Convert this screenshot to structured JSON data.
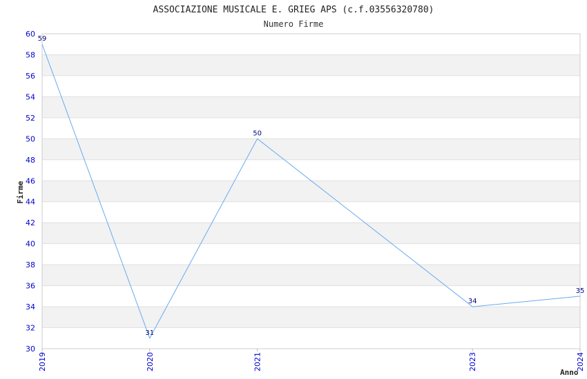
{
  "chart_data": {
    "type": "line",
    "title": "ASSOCIAZIONE MUSICALE E. GRIEG APS (c.f.03556320780)",
    "subtitle": "Numero Firme",
    "xlabel": "Anno",
    "ylabel": "Firme",
    "x": [
      "2019",
      "2020",
      "2021",
      "2023",
      "2024"
    ],
    "x_positions": [
      2019,
      2020,
      2021,
      2023,
      2024
    ],
    "values": [
      59,
      31,
      50,
      34,
      35
    ],
    "ylim": [
      30,
      60
    ],
    "ystep": 2,
    "grid": "horizontal alternating bands",
    "colors": {
      "line": "#66aaee",
      "band": "#f2f2f2",
      "tick": "#0000cc",
      "label": "#000080"
    }
  }
}
